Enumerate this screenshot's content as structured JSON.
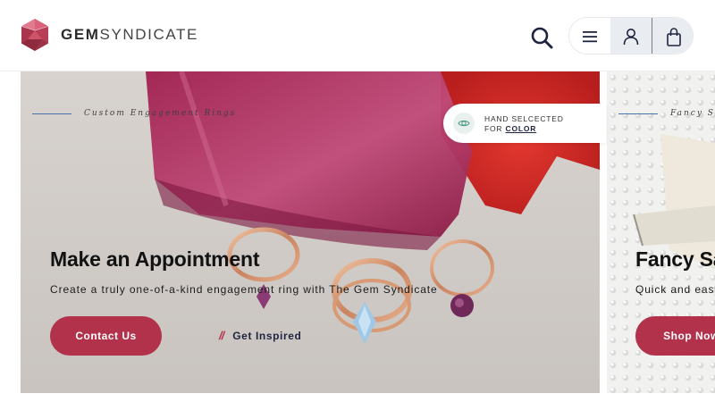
{
  "header": {
    "logo_bold": "GEM",
    "logo_light": "SYNDICATE",
    "icons": {
      "logo": "gem-logo-icon",
      "search": "search-icon",
      "menu": "hamburger-menu-icon",
      "account": "user-icon",
      "cart": "shopping-bag-icon"
    }
  },
  "hero": {
    "eyebrow": "Custom Engagement Rings",
    "badge_line1": "HAND SELCECTED",
    "badge_line2_prefix": "FOR ",
    "badge_line2_accent": "COLOR",
    "badge_icon": "gem-eye-icon",
    "title": "Make an Appointment",
    "subtitle": "Create a truly one-of-a-kind engagement ring with The Gem Syndicate",
    "primary_button": "Contact Us",
    "secondary_link_mark": "//",
    "secondary_link": "Get Inspired"
  },
  "next_slide": {
    "eyebrow": "Fancy Sapphires",
    "title": "Fancy Sapphires",
    "subtitle": "Quick and easy",
    "primary_button": "Shop Now"
  },
  "colors": {
    "accent": "#b3324b",
    "eyebrow_line": "#4c72a8",
    "nav_pill_bg": "#e9ecf1",
    "logo": "#b3324b"
  }
}
